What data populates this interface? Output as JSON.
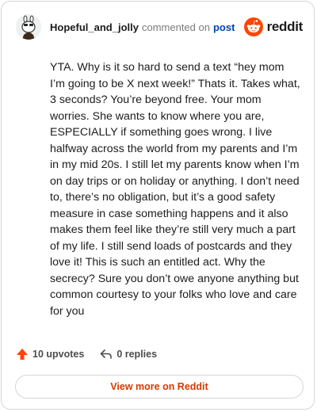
{
  "header": {
    "username": "Hopeful_and_jolly",
    "action": "commented on",
    "post_link": "post",
    "brand": "reddit"
  },
  "comment": {
    "text": "YTA. Why is it so hard to send a text “hey mom I’m going to be X next week!” Thats it. Takes what, 3 seconds? You’re beyond free. Your mom worries. She wants to know where you are, ESPECIALLY if something goes wrong. I live halfway across the world from my parents and I’m in my mid 20s. I still let my parents know when I’m on day trips or on holiday or anything. I don’t need to, there’s no obligation, but it’s a good safety measure in case something happens and it also makes them feel like they’re still very much a part of my life. I still send loads of postcards and they love it! This is such an entitled act. Why the secrecy? Sure you don’t owe anyone anything but common courtesy to your folks who love and care for you"
  },
  "footer": {
    "upvotes": "10 upvotes",
    "replies": "0 replies",
    "view_more": "View more on Reddit"
  },
  "colors": {
    "accent": "#ff4500",
    "link": "#0045ac",
    "view_more_text": "#d93900"
  },
  "icons": {
    "avatar": "snoo-avatar-icon",
    "brand": "reddit-logo-icon",
    "upvote": "upvote-arrow-icon",
    "reply": "reply-arrow-icon"
  }
}
